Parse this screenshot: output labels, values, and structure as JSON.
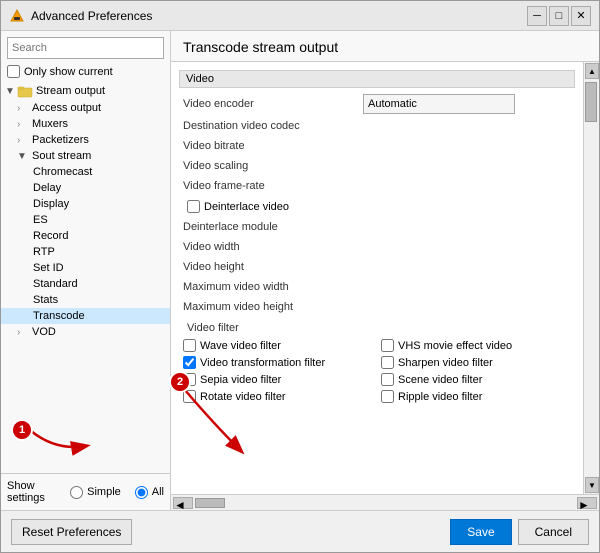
{
  "window": {
    "title": "Advanced Preferences",
    "icon": "vlc"
  },
  "left_panel": {
    "search_placeholder": "Search",
    "only_show_current_label": "Only show current",
    "tree": [
      {
        "id": "stream_output",
        "level": 0,
        "label": "Stream output",
        "arrow": "▼",
        "has_icon": true,
        "expanded": true
      },
      {
        "id": "access_output",
        "level": 1,
        "label": "Access output",
        "arrow": "›"
      },
      {
        "id": "muxers",
        "level": 1,
        "label": "Muxers",
        "arrow": "›"
      },
      {
        "id": "packetizers",
        "level": 1,
        "label": "Packetizers",
        "arrow": "›"
      },
      {
        "id": "sout_stream",
        "level": 1,
        "label": "Sout stream",
        "arrow": "▼",
        "expanded": true
      },
      {
        "id": "chromecast",
        "level": 2,
        "label": "Chromecast"
      },
      {
        "id": "delay",
        "level": 2,
        "label": "Delay"
      },
      {
        "id": "display",
        "level": 2,
        "label": "Display"
      },
      {
        "id": "es",
        "level": 2,
        "label": "ES"
      },
      {
        "id": "record",
        "level": 2,
        "label": "Record"
      },
      {
        "id": "rtp",
        "level": 2,
        "label": "RTP"
      },
      {
        "id": "set_id",
        "level": 2,
        "label": "Set ID"
      },
      {
        "id": "standard",
        "level": 2,
        "label": "Standard"
      },
      {
        "id": "stats",
        "level": 2,
        "label": "Stats"
      },
      {
        "id": "transcode",
        "level": 2,
        "label": "Transcode",
        "selected": true
      },
      {
        "id": "vod",
        "level": 1,
        "label": "VOD",
        "arrow": "›"
      }
    ],
    "show_settings_label": "Show settings",
    "simple_label": "Simple",
    "all_label": "All"
  },
  "right_panel": {
    "title": "Transcode stream output",
    "video_section": "Video",
    "settings": [
      {
        "id": "video_encoder",
        "label": "Video encoder",
        "value": "Automatic",
        "type": "input"
      },
      {
        "id": "dest_video_codec",
        "label": "Destination video codec",
        "value": "",
        "type": "text"
      },
      {
        "id": "video_bitrate",
        "label": "Video bitrate",
        "value": "",
        "type": "text"
      },
      {
        "id": "video_scaling",
        "label": "Video scaling",
        "value": "",
        "type": "text"
      },
      {
        "id": "video_framerate",
        "label": "Video frame-rate",
        "value": "",
        "type": "text"
      },
      {
        "id": "deinterlace_video",
        "label": "Deinterlace video",
        "value": false,
        "type": "checkbox"
      },
      {
        "id": "deinterlace_module",
        "label": "Deinterlace module",
        "value": "",
        "type": "text"
      },
      {
        "id": "video_width",
        "label": "Video width",
        "value": "",
        "type": "text"
      },
      {
        "id": "video_height",
        "label": "Video height",
        "value": "",
        "type": "text"
      },
      {
        "id": "max_video_width",
        "label": "Maximum video width",
        "value": "",
        "type": "text"
      },
      {
        "id": "max_video_height",
        "label": "Maximum video height",
        "value": "",
        "type": "text"
      }
    ],
    "video_filter_section": "Video filter",
    "filters_left": [
      {
        "id": "wave_filter",
        "label": "Wave video filter",
        "checked": false
      },
      {
        "id": "transform_filter",
        "label": "Video transformation filter",
        "checked": true
      },
      {
        "id": "sepia_filter",
        "label": "Sepia video filter",
        "checked": false
      },
      {
        "id": "rotate_filter",
        "label": "Rotate video filter",
        "checked": false
      }
    ],
    "filters_right": [
      {
        "id": "vhs_filter",
        "label": "VHS movie effect video",
        "checked": false
      },
      {
        "id": "sharpen_filter",
        "label": "Sharpen video filter",
        "checked": false
      },
      {
        "id": "scene_filter",
        "label": "Scene video filter",
        "checked": false
      },
      {
        "id": "ripple_filter",
        "label": "Ripple video filter",
        "checked": false
      }
    ]
  },
  "bottom": {
    "reset_label": "Reset Preferences",
    "save_label": "Save",
    "cancel_label": "Cancel"
  },
  "annotations": [
    {
      "id": "1",
      "label": "1"
    },
    {
      "id": "2",
      "label": "2"
    }
  ]
}
